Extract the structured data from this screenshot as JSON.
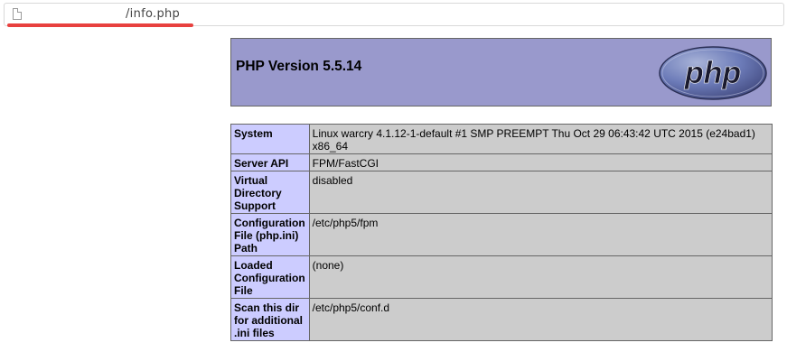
{
  "browser": {
    "url": "/info.php"
  },
  "header": {
    "title": "PHP Version 5.5.14",
    "logo_text": "php"
  },
  "rows": [
    {
      "key": "System",
      "value": "Linux warcry 4.1.12-1-default #1 SMP PREEMPT Thu Oct 29 06:43:42 UTC 2015 (e24bad1) x86_64"
    },
    {
      "key": "Server API",
      "value": "FPM/FastCGI"
    },
    {
      "key": "Virtual Directory Support",
      "value": "disabled"
    },
    {
      "key": "Configuration File (php.ini) Path",
      "value": "/etc/php5/fpm"
    },
    {
      "key": "Loaded Configuration File",
      "value": "(none)"
    },
    {
      "key": "Scan this dir for additional .ini files",
      "value": "/etc/php5/conf.d"
    }
  ],
  "colors": {
    "header_bg": "#9999cc",
    "key_bg": "#ccccff",
    "value_bg": "#cccccc",
    "redaction": "#e8413f"
  },
  "icons": {
    "address_bar": "page-icon"
  }
}
